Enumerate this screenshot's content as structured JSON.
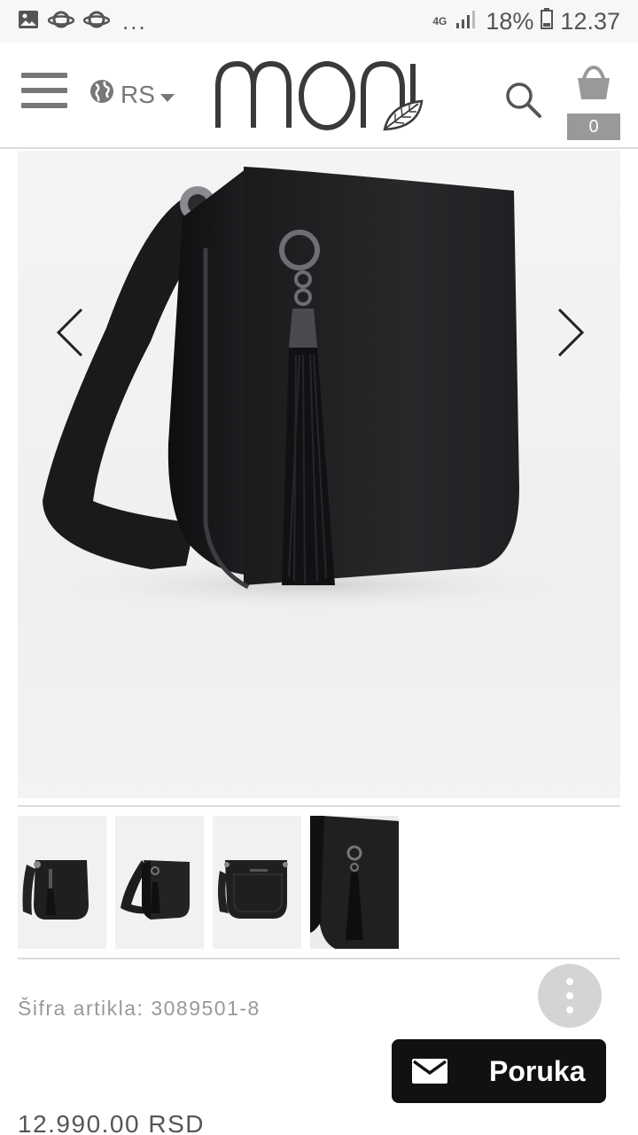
{
  "status_bar": {
    "network": "4G",
    "battery": "18%",
    "time": "12.37",
    "more": "..."
  },
  "header": {
    "language": "RS",
    "logo_text": "mona",
    "cart_count": "0"
  },
  "product": {
    "sku_label": "Šifra artikla: 3089501-8",
    "price": "12.990.00 RSD",
    "thumbnail_count": 4
  },
  "actions": {
    "message_label": "Poruka"
  },
  "icons": {
    "menu": "hamburger-icon",
    "globe": "globe-icon",
    "search": "search-icon",
    "cart": "basket-icon",
    "prev": "chevron-left-icon",
    "next": "chevron-right-icon",
    "more": "more-vertical-icon",
    "mail": "mail-icon"
  },
  "colors": {
    "accent_dark": "#111111",
    "header_gray": "#777777",
    "cart_badge": "#999999",
    "fab_gray": "#d4d4d4"
  }
}
